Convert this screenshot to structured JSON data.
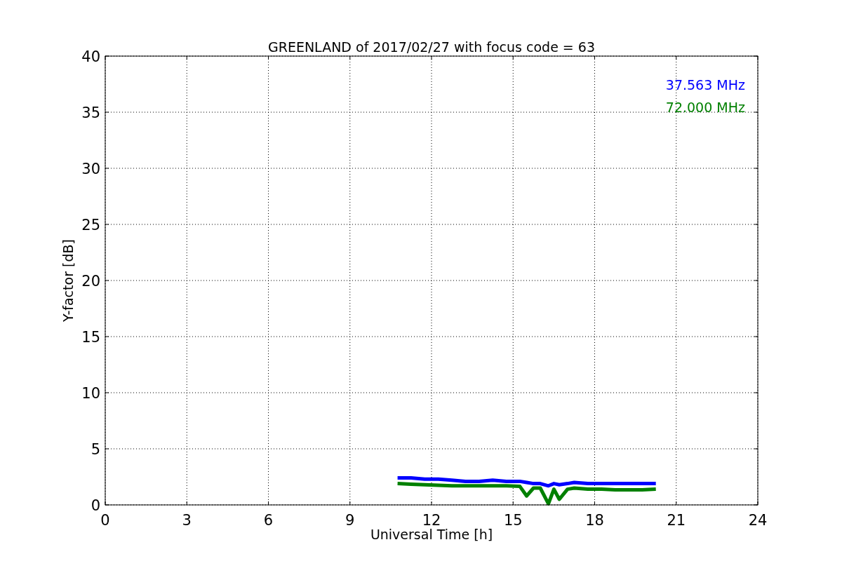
{
  "plot": {
    "chart_data": {
      "type": "line",
      "title": "GREENLAND of 2017/02/27 with focus code = 63",
      "xlabel": "Universal Time [h]",
      "ylabel": "Y-factor [dB]",
      "x": [
        10.75,
        11.25,
        11.75,
        12.25,
        12.75,
        13.25,
        13.75,
        14.25,
        14.75,
        15.25,
        15.5,
        15.75,
        16.0,
        16.3,
        16.5,
        16.7,
        17.0,
        17.25,
        17.75,
        18.25,
        18.75,
        19.25,
        19.75,
        20.25
      ],
      "series": [
        {
          "name": "37.563 MHz",
          "color": "#0000ff",
          "values": [
            2.4,
            2.4,
            2.3,
            2.3,
            2.2,
            2.1,
            2.1,
            2.2,
            2.1,
            2.1,
            2.0,
            1.9,
            1.9,
            1.7,
            1.9,
            1.8,
            1.9,
            2.0,
            1.9,
            1.9,
            1.9,
            1.9,
            1.9,
            1.9
          ]
        },
        {
          "name": "72.000 MHz",
          "color": "#008000",
          "values": [
            1.9,
            1.85,
            1.8,
            1.75,
            1.7,
            1.7,
            1.7,
            1.7,
            1.7,
            1.65,
            0.8,
            1.5,
            1.5,
            0.1,
            1.4,
            0.5,
            1.4,
            1.5,
            1.4,
            1.4,
            1.35,
            1.35,
            1.35,
            1.4
          ]
        }
      ],
      "xlim": [
        0,
        24
      ],
      "ylim": [
        0,
        40
      ],
      "grid": true,
      "xticks": [
        0,
        3,
        6,
        9,
        12,
        15,
        18,
        21,
        24
      ],
      "yticks": [
        0,
        5,
        10,
        15,
        20,
        25,
        30,
        35,
        40
      ]
    }
  }
}
